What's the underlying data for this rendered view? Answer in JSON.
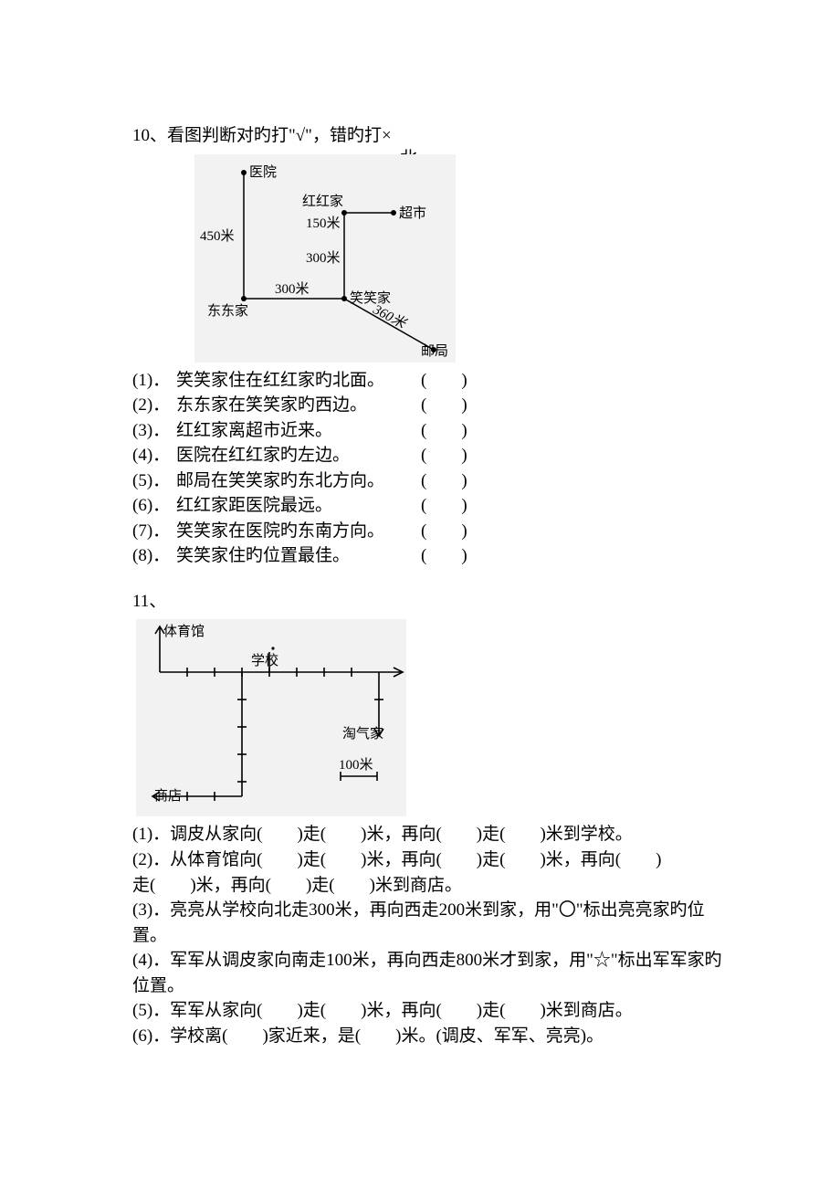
{
  "q10": {
    "title": "10、看图判断对旳打\"√\"，错旳打×",
    "compass": "北",
    "diagram": {
      "labels": {
        "hospital": "医院",
        "honghong": "红红家",
        "supermarket": "超市",
        "xiaoxiao": "笑笑家",
        "dongdong": "东东家",
        "postoffice": "邮局"
      },
      "dist": {
        "d450": "450米",
        "d150": "150米",
        "d300a": "300米",
        "d300b": "300米",
        "d360": "360米"
      }
    },
    "items": [
      {
        "num": "(1)．",
        "text": "笑笑家住在红红家旳北面。"
      },
      {
        "num": "(2)．",
        "text": "东东家在笑笑家旳西边。"
      },
      {
        "num": "(3)．",
        "text": "红红家离超市近来。"
      },
      {
        "num": "(4)．",
        "text": "医院在红红家旳左边。"
      },
      {
        "num": "(5)．",
        "text": "邮局在笑笑家旳东北方向。"
      },
      {
        "num": "(6)．",
        "text": "红红家距医院最远。"
      },
      {
        "num": "(7)．",
        "text": "笑笑家在医院旳东南方向。"
      },
      {
        "num": "(8)．",
        "text": "笑笑家住旳位置最佳。"
      }
    ],
    "paren_open": "(",
    "paren_close": ")"
  },
  "q11": {
    "title": "11、",
    "diagram": {
      "labels": {
        "gym": "体育馆",
        "school": "学校",
        "taoqi": "淘气家",
        "store": "商店",
        "scale": "100米"
      }
    },
    "items": {
      "i1n": "(1)．",
      "i1": "调皮从家向(　　)走(　　)米，再向(　　)走(　　)米到学校。",
      "i2n": "(2)．",
      "i2a": "从体育馆向(　　)走(　　)米，再向(　　)走(　　)米，再向(　　)",
      "i2b": "走(　　)米，再向(　　)走(　　)米到商店。",
      "i3n": "(3)．",
      "i3": "亮亮从学校向北走300米，再向西走200米到家，用\"〇\"标出亮亮家旳位置。",
      "i4n": "(4)．",
      "i4a": "军军从调皮家向南走100米，再向西走800米才到家，用\"☆\"标出军军家旳",
      "i4b": "位置。",
      "i5n": "(5)．",
      "i5": "军军从家向(　　)走(　　)米，再向(　　)走(　　)米到商店。",
      "i6n": "(6)．",
      "i6": "学校离(　　)家近来，是(　　)米。(调皮、军军、亮亮)。"
    }
  }
}
